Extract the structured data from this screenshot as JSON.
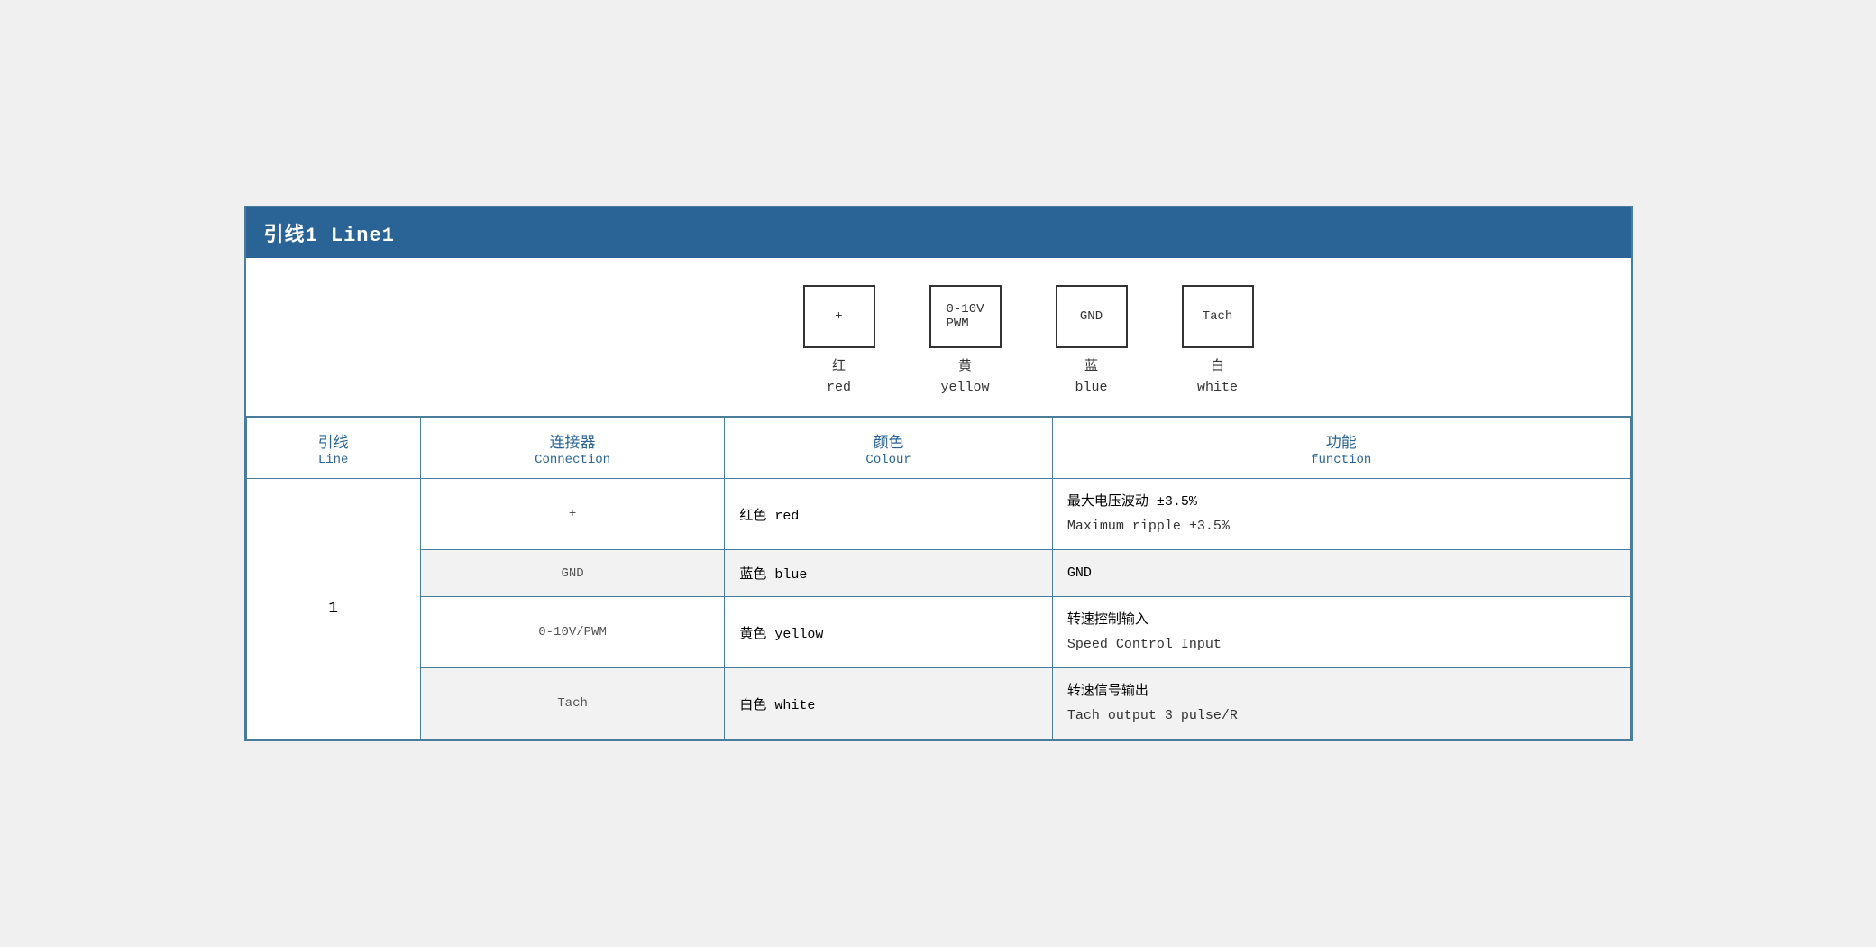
{
  "header": {
    "title": "引线1 Line1"
  },
  "diagram": {
    "connectors": [
      {
        "id": "plus",
        "symbol": "+",
        "zh": "红",
        "en": "red"
      },
      {
        "id": "pwm",
        "symbol": "0-10V\nPWM",
        "zh": "黄",
        "en": "yellow"
      },
      {
        "id": "gnd",
        "symbol": "GND",
        "zh": "蓝",
        "en": "blue"
      },
      {
        "id": "tach",
        "symbol": "Tach",
        "zh": "白",
        "en": "white"
      }
    ]
  },
  "table": {
    "headers": [
      {
        "zh": "引线",
        "en": "Line"
      },
      {
        "zh": "连接器",
        "en": "Connection"
      },
      {
        "zh": "颜色",
        "en": "Colour"
      },
      {
        "zh": "功能",
        "en": "function"
      }
    ],
    "rows": [
      {
        "line": "1",
        "connection": "+",
        "color": "红色 red",
        "func_zh": "最大电压波动 ±3.5%",
        "func_en": "Maximum ripple ±3.5%",
        "rowspan": 4,
        "rowClass": "odd-row"
      },
      {
        "connection": "GND",
        "color": "蓝色 blue",
        "func_zh": "GND",
        "func_en": "",
        "rowClass": "even-row"
      },
      {
        "connection": "0-10V/PWM",
        "color": "黄色 yellow",
        "func_zh": "转速控制输入",
        "func_en": "Speed Control Input",
        "rowClass": "odd-row"
      },
      {
        "connection": "Tach",
        "color": "白色 white",
        "func_zh": "转速信号输出",
        "func_en": "Tach output 3 pulse/R",
        "rowClass": "even-row"
      }
    ]
  }
}
